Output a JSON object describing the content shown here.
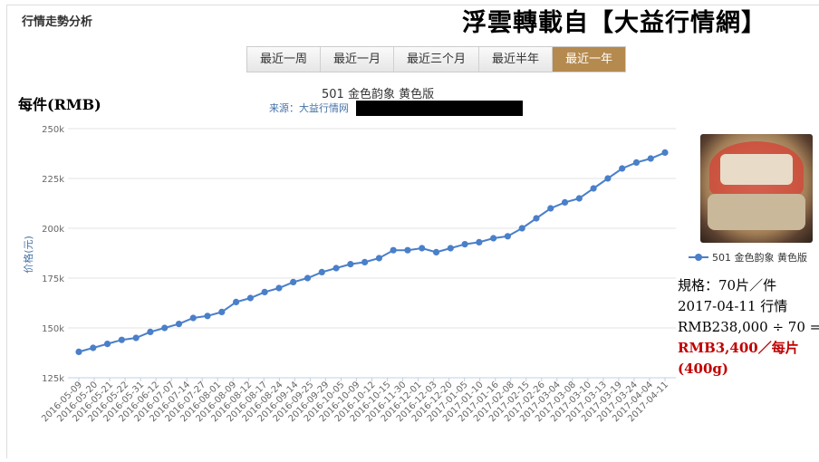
{
  "header": {
    "panel_title": "行情走勢分析",
    "headline": "浮雲轉載自【大益行情網】"
  },
  "tabs": [
    {
      "label": "最近一周",
      "active": false
    },
    {
      "label": "最近一月",
      "active": false
    },
    {
      "label": "最近三个月",
      "active": false
    },
    {
      "label": "最近半年",
      "active": false
    },
    {
      "label": "最近一年",
      "active": true
    }
  ],
  "unit_label": "每件(RMB)",
  "chart_data": {
    "type": "line",
    "title": "501 金色韵象 黄色版",
    "source": "来源：大益行情网",
    "ylabel": "价格(元)",
    "xlabel": "",
    "ylim": [
      125000,
      250000
    ],
    "yticks": [
      125000,
      150000,
      175000,
      200000,
      225000,
      250000
    ],
    "ytick_labels": [
      "125k",
      "150k",
      "175k",
      "200k",
      "225k",
      "250k"
    ],
    "grid": true,
    "legend": "right",
    "color": "#4a7fc9",
    "categories": [
      "2016-05-09",
      "2016-05-20",
      "2016-05-21",
      "2016-05-22",
      "2016-05-31",
      "2016-06-12",
      "2016-07-07",
      "2016-07-14",
      "2016-07-27",
      "2016-08-01",
      "2016-08-09",
      "2016-08-12",
      "2016-08-17",
      "2016-08-24",
      "2016-09-14",
      "2016-09-25",
      "2016-09-29",
      "2016-10-05",
      "2016-10-09",
      "2016-10-12",
      "2016-10-15",
      "2016-11-30",
      "2016-12-01",
      "2016-12-03",
      "2016-12-20",
      "2017-01-05",
      "2017-01-10",
      "2017-01-16",
      "2017-02-08",
      "2017-02-15",
      "2017-02-26",
      "2017-03-04",
      "2017-03-08",
      "2017-03-10",
      "2017-03-13",
      "2017-03-19",
      "2017-03-24",
      "2017-04-04",
      "2017-04-11"
    ],
    "series": [
      {
        "name": "501 金色韵象 黄色版",
        "values": [
          138000,
          140000,
          142000,
          144000,
          145000,
          148000,
          150000,
          152000,
          155000,
          156000,
          158000,
          163000,
          165000,
          168000,
          170000,
          173000,
          175000,
          178000,
          180000,
          182000,
          183000,
          185000,
          189000,
          189000,
          190000,
          188000,
          190000,
          192000,
          193000,
          195000,
          196000,
          200000,
          205000,
          210000,
          213000,
          215000,
          220000,
          225000,
          230000,
          233000,
          235000,
          238000
        ]
      }
    ]
  },
  "product_image": {
    "icon": "tea-cake-photo"
  },
  "note": {
    "line1": "規格：70片／件",
    "line2": "2017-04-11 行情",
    "line3": "RMB238,000 ÷ 70 =",
    "line4": "RMB3,400／每片",
    "line5": "(400g)"
  }
}
